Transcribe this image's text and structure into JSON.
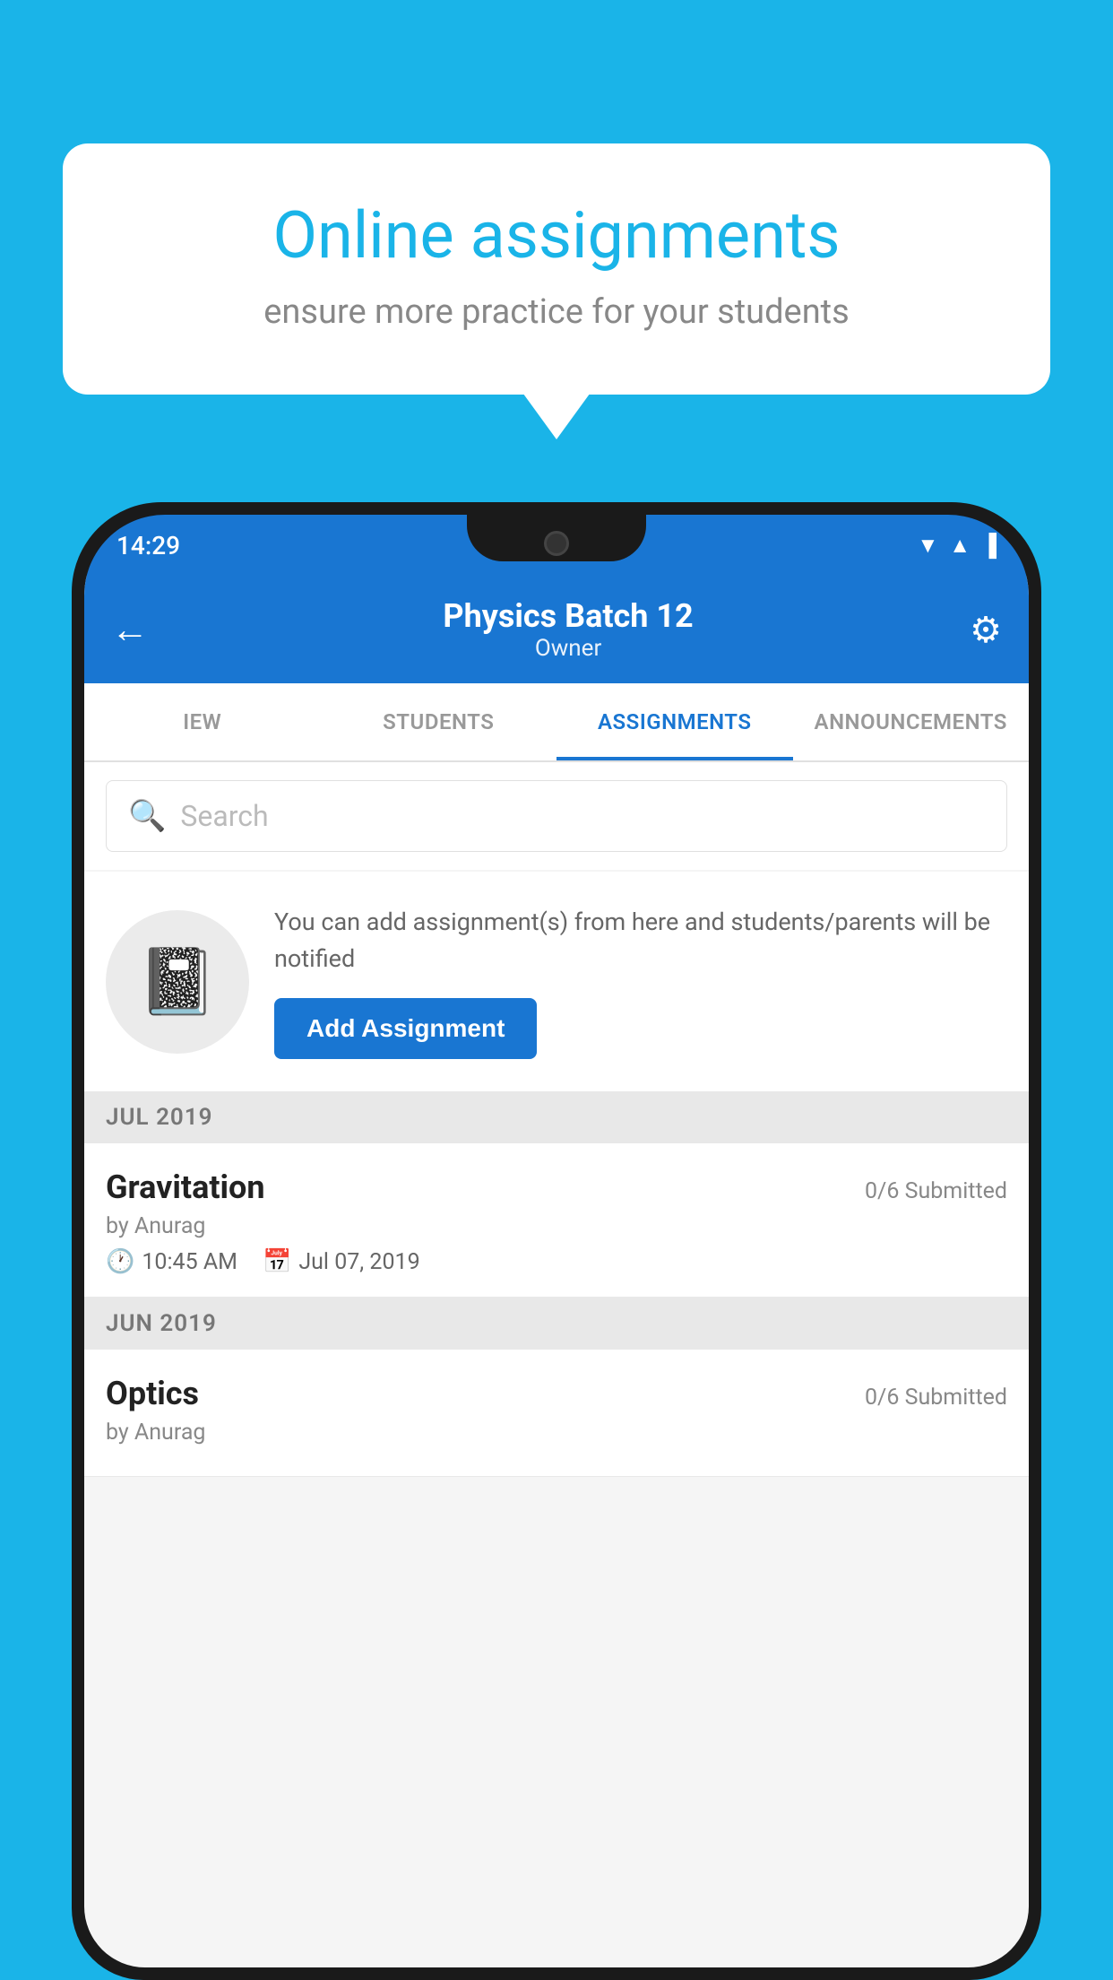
{
  "background_color": "#1ab4e8",
  "speech_bubble": {
    "title": "Online assignments",
    "subtitle": "ensure more practice for your students"
  },
  "phone": {
    "status_bar": {
      "time": "14:29",
      "icons": [
        "wifi",
        "signal",
        "battery"
      ]
    },
    "header": {
      "title": "Physics Batch 12",
      "subtitle": "Owner",
      "back_label": "←",
      "gear_label": "⚙"
    },
    "tabs": [
      {
        "label": "IEW",
        "active": false
      },
      {
        "label": "STUDENTS",
        "active": false
      },
      {
        "label": "ASSIGNMENTS",
        "active": true
      },
      {
        "label": "ANNOUNCEMENTS",
        "active": false
      }
    ],
    "search": {
      "placeholder": "Search"
    },
    "promo": {
      "text": "You can add assignment(s) from here and students/parents will be notified",
      "button_label": "Add Assignment"
    },
    "sections": [
      {
        "label": "JUL 2019",
        "assignments": [
          {
            "name": "Gravitation",
            "submitted": "0/6 Submitted",
            "author": "by Anurag",
            "time": "10:45 AM",
            "date": "Jul 07, 2019"
          }
        ]
      },
      {
        "label": "JUN 2019",
        "assignments": [
          {
            "name": "Optics",
            "submitted": "0/6 Submitted",
            "author": "by Anurag",
            "time": "",
            "date": ""
          }
        ]
      }
    ]
  }
}
